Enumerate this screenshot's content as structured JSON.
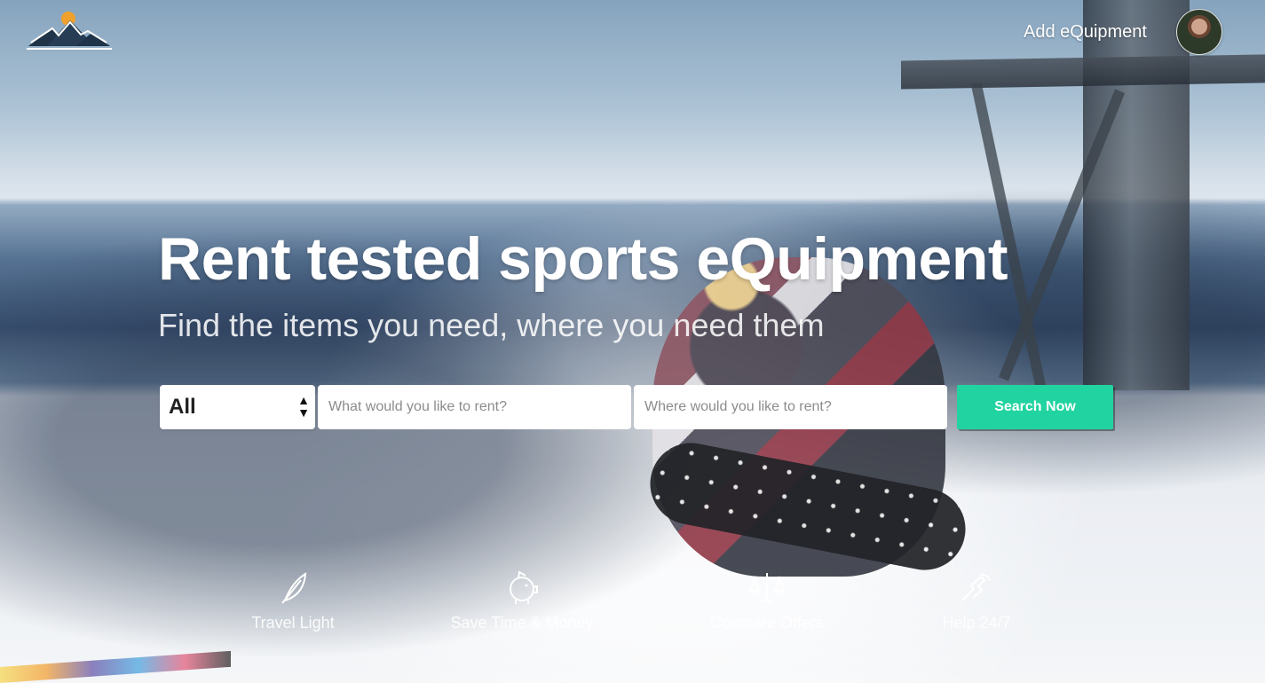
{
  "header": {
    "add_link": "Add eQuipment"
  },
  "hero": {
    "headline_strong": "Rent",
    "headline_rest": " tested sports eQuipment",
    "subheadline": "Find the items you need, where you need them"
  },
  "search": {
    "category_value": "All",
    "what_placeholder": "What would you like to rent?",
    "where_placeholder": "Where would you like to rent?",
    "button_label": "Search Now"
  },
  "features": [
    {
      "icon": "feather-icon",
      "label": "Travel Light"
    },
    {
      "icon": "piggy-bank-icon",
      "label": "Save Time & Money"
    },
    {
      "icon": "scale-icon",
      "label": "Compare Offers"
    },
    {
      "icon": "help-icon",
      "label": "Help 24/7"
    }
  ],
  "colors": {
    "accent": "#21d3a0",
    "logo_sun": "#f0a12b"
  }
}
